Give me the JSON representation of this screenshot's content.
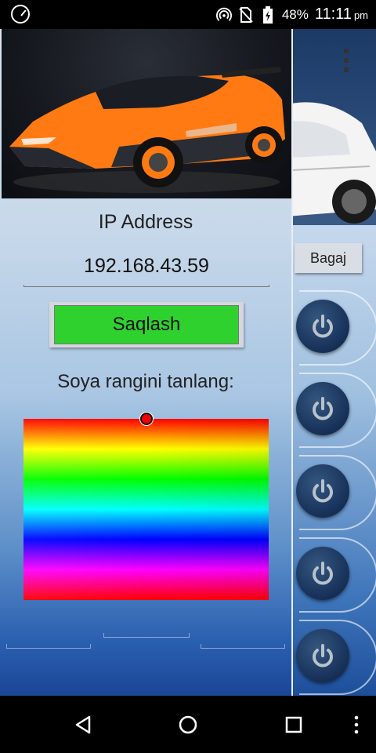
{
  "status_bar": {
    "battery": "48%",
    "time": "11:11",
    "ampm": "pm",
    "icons": [
      "speedometer-icon",
      "hotspot-icon",
      "no-sim-icon",
      "battery-charging-icon"
    ]
  },
  "drawer": {
    "ip_label": "IP Address",
    "ip_value": "192.168.43.59",
    "save_label": "Saqlash",
    "color_prompt": "Soya rangini tanlang:",
    "picker_marker_color": "#e00000"
  },
  "background_app": {
    "bagaj_label": "Bagaj",
    "power_buttons": 5
  },
  "colors": {
    "save_green": "#2fd12f",
    "status_bar": "#000000",
    "nav_bar": "#000000",
    "power_button": "#1a355e"
  },
  "nav": {
    "icons": [
      "back-icon",
      "home-icon",
      "recents-icon",
      "more-icon"
    ]
  }
}
